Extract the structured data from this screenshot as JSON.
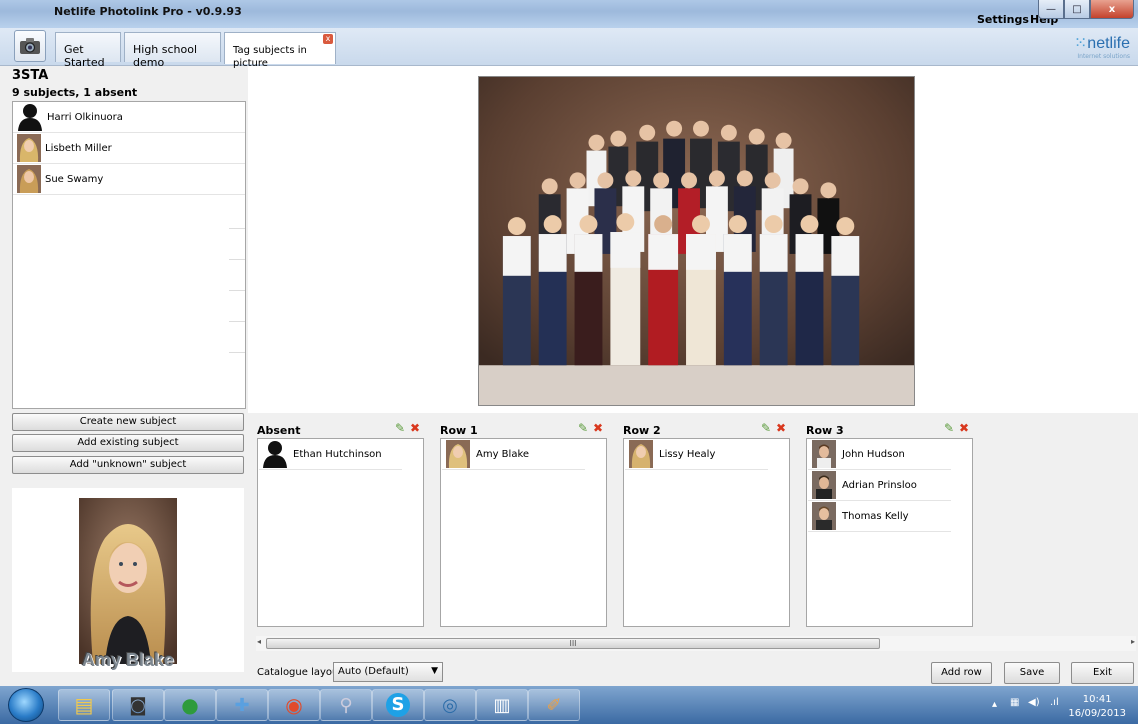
{
  "window": {
    "title": "Netlife Photolink Pro - v0.9.93",
    "menu_settings": "Settings",
    "menu_help": "Help",
    "minimize": "—",
    "maximize": "□",
    "close": "x"
  },
  "tabs": [
    {
      "label": "Get Started"
    },
    {
      "label": "High school demo"
    },
    {
      "label": "Tag subjects in picture",
      "close": "x"
    }
  ],
  "logo": {
    "name": "netlife",
    "sub": "Internet solutions"
  },
  "class": {
    "name": "3STA",
    "summary": "9 subjects, 1 absent"
  },
  "subjects": [
    {
      "name": "Harri Olkinuora",
      "avatar": "silhouette"
    },
    {
      "name": "Lisbeth Miller",
      "avatar": "photo"
    },
    {
      "name": "Sue Swamy",
      "avatar": "photo"
    }
  ],
  "buttons": {
    "create_new": "Create new subject",
    "add_existing": "Add existing subject",
    "add_unknown": "Add \"unknown\" subject",
    "add_row": "Add row",
    "save": "Save",
    "exit": "Exit"
  },
  "preview": {
    "caption": "Amy Blake"
  },
  "rows": [
    {
      "title": "Absent",
      "items": [
        {
          "name": "Ethan Hutchinson",
          "avatar": "silhouette"
        }
      ]
    },
    {
      "title": "Row 1",
      "items": [
        {
          "name": "Amy Blake",
          "avatar": "photo-blonde"
        }
      ]
    },
    {
      "title": "Row 2",
      "items": [
        {
          "name": "Lissy Healy",
          "avatar": "photo-blonde"
        }
      ]
    },
    {
      "title": "Row 3",
      "items": [
        {
          "name": "John Hudson",
          "avatar": "photo-male"
        },
        {
          "name": "Adrian Prinsloo",
          "avatar": "photo-male"
        },
        {
          "name": "Thomas Kelly",
          "avatar": "photo-male"
        }
      ]
    }
  ],
  "scrollbar": {
    "grip": "III"
  },
  "catalogue": {
    "label": "Catalogue layout",
    "value": "Auto (Default)"
  },
  "taskbar": {
    "time": "10:41",
    "date": "16/09/2013"
  },
  "colors": {
    "accent": "#2a6fb0",
    "taskbar": "#3b6aa3",
    "delete_red": "#d9381e"
  }
}
